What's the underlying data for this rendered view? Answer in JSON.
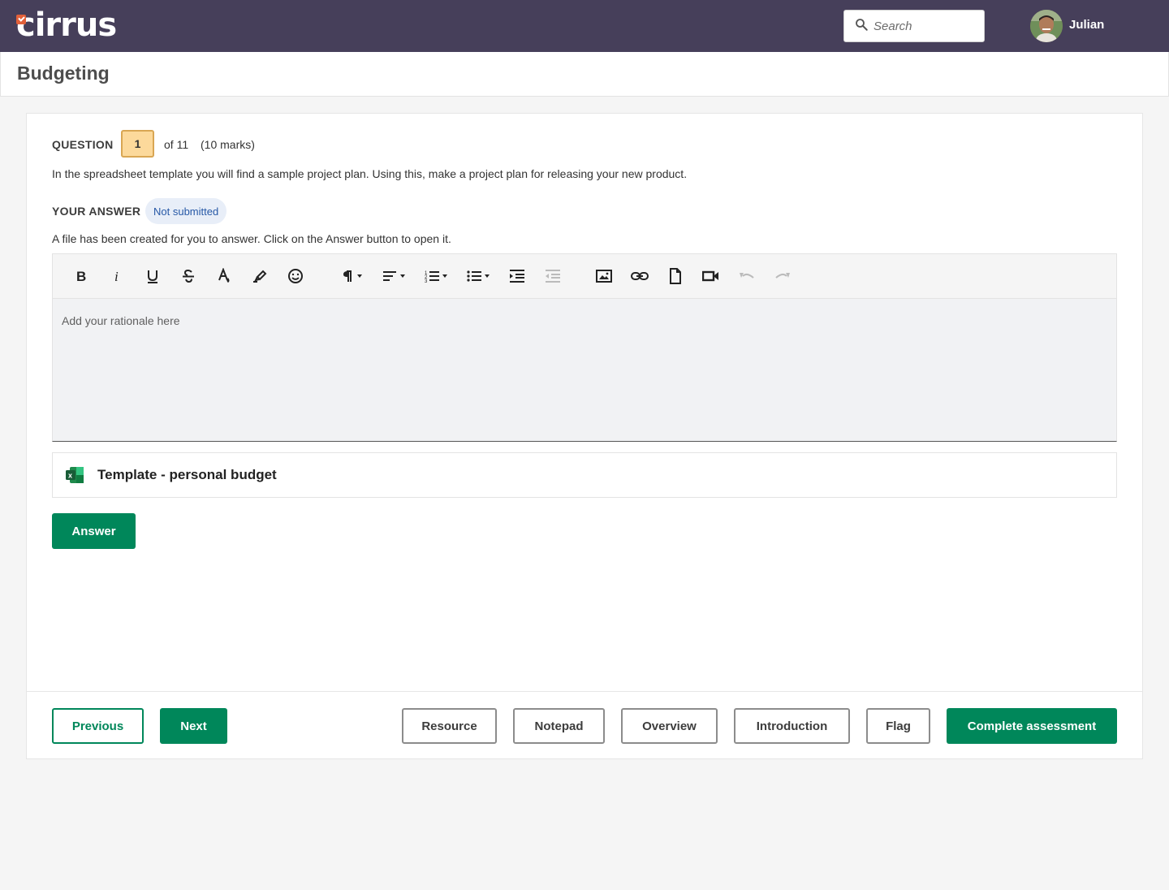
{
  "app": {
    "logo_text": "cirrus",
    "search_placeholder": "Search",
    "user_name": "Julian",
    "icons": {
      "search": "search-icon",
      "logo_mark": "check-mark-icon"
    },
    "colors": {
      "topbar": "#463f5a",
      "primary": "#00875a",
      "logo_mark": "#e2603a"
    }
  },
  "page": {
    "title": "Budgeting"
  },
  "question": {
    "label": "QUESTION",
    "number": "1",
    "of_total": "of 11",
    "marks": "(10 marks)",
    "text": "In the spreadsheet template you will find a sample project plan. Using this, make a project plan for releasing your new product."
  },
  "answer": {
    "label": "YOUR ANSWER",
    "status": "Not submitted",
    "help_text": "A file has been created for you to answer. Click on the Answer button to open it.",
    "editor_placeholder": "Add your rationale here",
    "toolbar": [
      "bold-icon",
      "italic-icon",
      "underline-icon",
      "strikethrough-icon",
      "text-color-icon",
      "highlight-icon",
      "emoji-icon",
      "paragraph-format-icon",
      "align-icon",
      "ordered-list-icon",
      "unordered-list-icon",
      "indent-icon",
      "outdent-icon",
      "insert-image-icon",
      "insert-link-icon",
      "insert-file-icon",
      "insert-video-icon",
      "undo-icon",
      "redo-icon"
    ],
    "file": {
      "name": "Template - personal budget",
      "icon": "excel-file-icon"
    },
    "answer_button": "Answer"
  },
  "footer": {
    "previous": "Previous",
    "next": "Next",
    "resource": "Resource",
    "notepad": "Notepad",
    "overview": "Overview",
    "introduction": "Introduction",
    "flag": "Flag",
    "complete": "Complete assessment"
  }
}
